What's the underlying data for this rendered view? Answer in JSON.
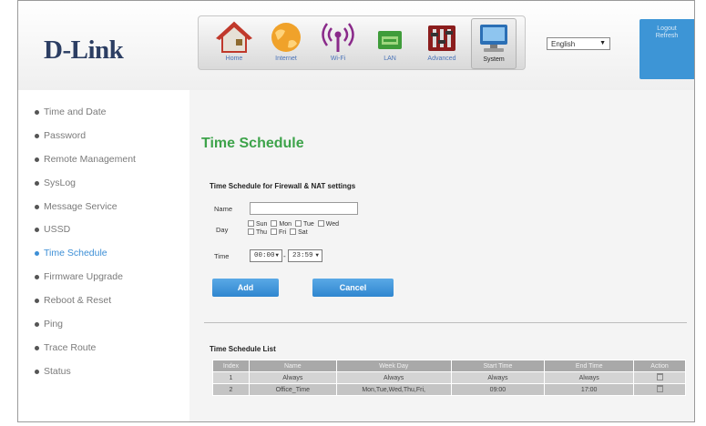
{
  "header": {
    "logo": "D-Link",
    "nav": [
      {
        "label": "Home",
        "icon": "home-icon"
      },
      {
        "label": "Internet",
        "icon": "globe-icon"
      },
      {
        "label": "Wi-Fi",
        "icon": "wifi-icon"
      },
      {
        "label": "LAN",
        "icon": "lan-icon"
      },
      {
        "label": "Advanced",
        "icon": "advanced-icon"
      },
      {
        "label": "System",
        "icon": "system-icon"
      }
    ],
    "language": "English",
    "logout": "Logout",
    "refresh": "Refresh"
  },
  "sidebar": {
    "items": [
      {
        "label": "Time and Date"
      },
      {
        "label": "Password"
      },
      {
        "label": "Remote Management"
      },
      {
        "label": "SysLog"
      },
      {
        "label": "Message Service"
      },
      {
        "label": "USSD"
      },
      {
        "label": "Time Schedule"
      },
      {
        "label": "Firmware Upgrade"
      },
      {
        "label": "Reboot & Reset"
      },
      {
        "label": "Ping"
      },
      {
        "label": "Trace Route"
      },
      {
        "label": "Status"
      }
    ]
  },
  "main": {
    "title": "Time Schedule",
    "section_title": "Time Schedule for Firewall & NAT settings",
    "form": {
      "name_label": "Name",
      "name_value": "",
      "day_label": "Day",
      "days": [
        "Sun",
        "Mon",
        "Tue",
        "Wed",
        "Thu",
        "Fri",
        "Sat"
      ],
      "time_label": "Time",
      "start_time": "00:00",
      "end_time": "23:59",
      "separator": "-"
    },
    "buttons": {
      "add": "Add",
      "cancel": "Cancel"
    },
    "list": {
      "title": "Time Schedule List",
      "columns": [
        "Index",
        "Name",
        "Week Day",
        "Start Time",
        "End Time",
        "Action"
      ],
      "rows": [
        {
          "index": "1",
          "name": "Always",
          "week_day": "Always",
          "start": "Always",
          "end": "Always"
        },
        {
          "index": "2",
          "name": "Office_Time",
          "week_day": "Mon,Tue,Wed,Thu,Fri,",
          "start": "09:00",
          "end": "17:00"
        }
      ]
    }
  },
  "colors": {
    "accent": "#3d8fd6",
    "title_green": "#3da34a",
    "logo_navy": "#2c3e63"
  }
}
